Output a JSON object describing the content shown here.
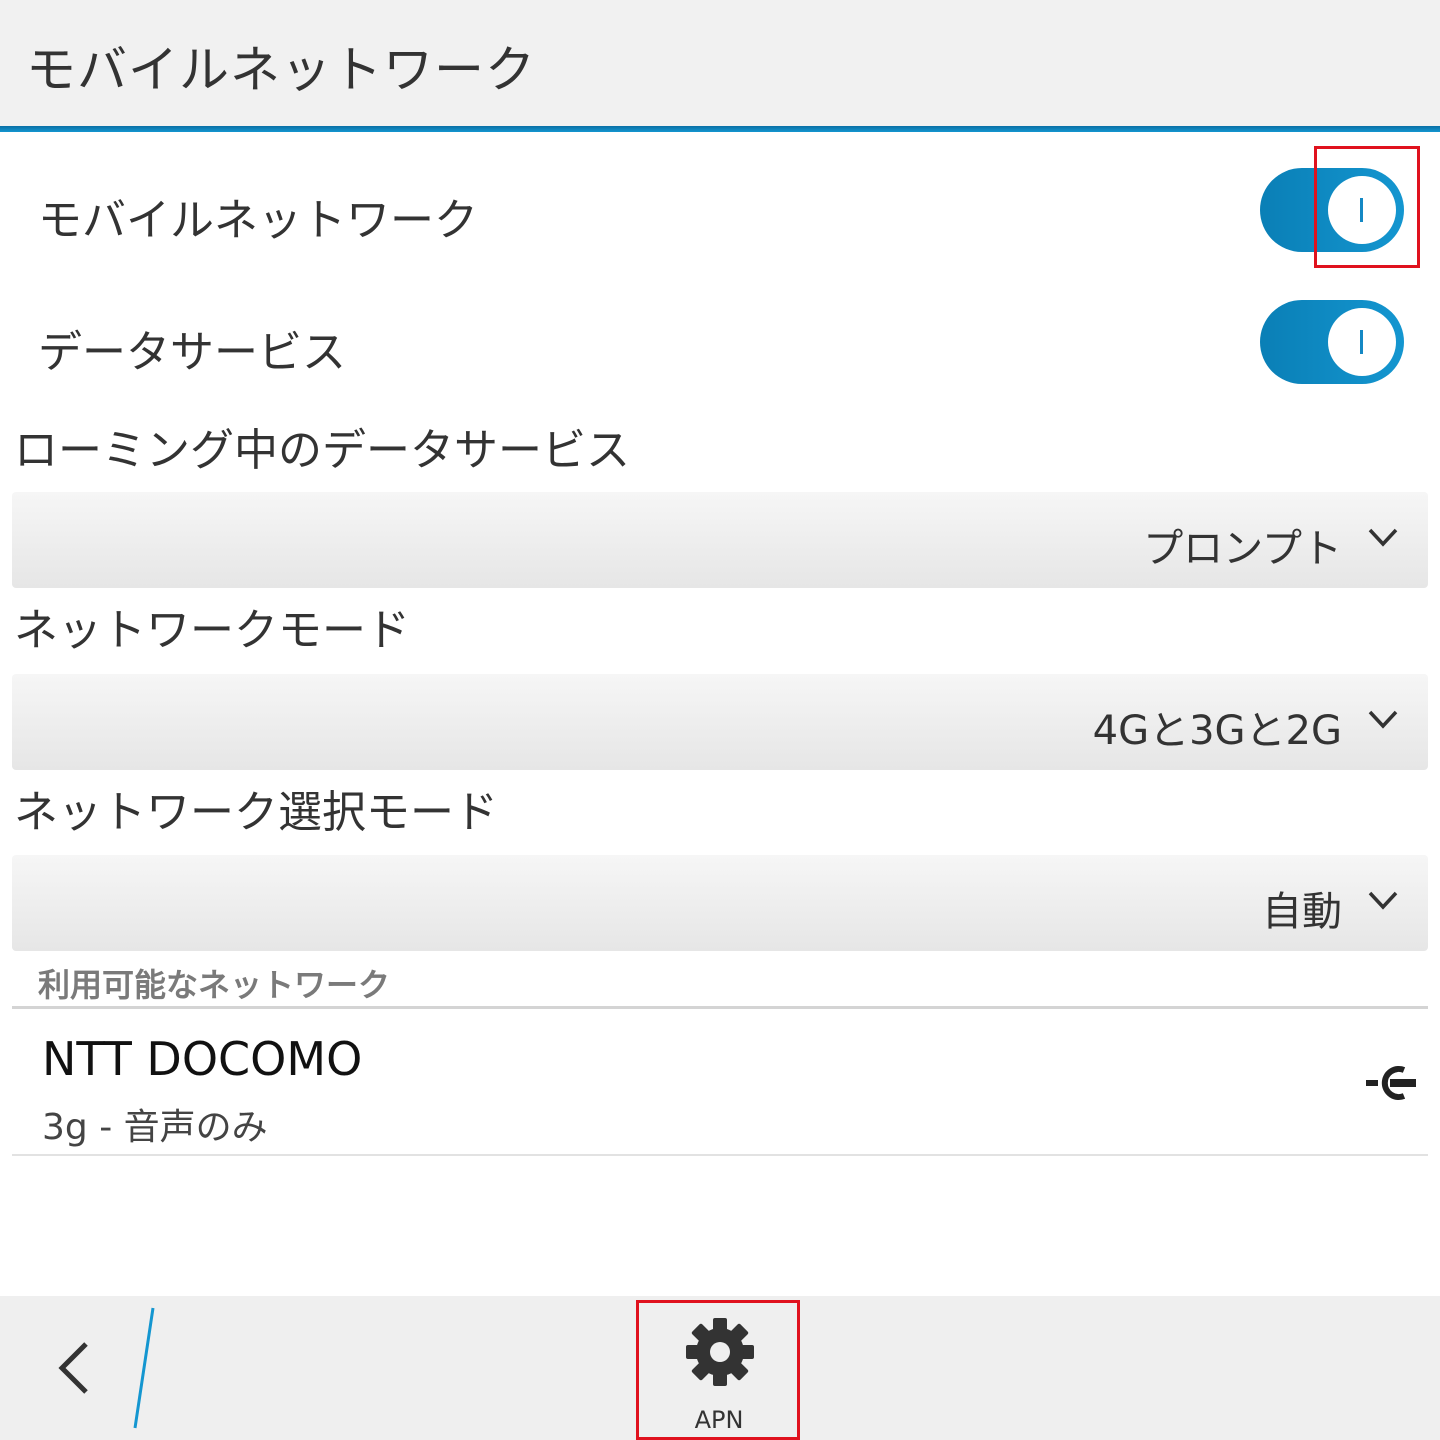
{
  "header": {
    "title": "モバイルネットワーク"
  },
  "mobile_network": {
    "label": "モバイルネットワーク",
    "state": "on"
  },
  "data_service": {
    "label": "データサービス",
    "state": "on"
  },
  "roaming": {
    "label": "ローミング中のデータサービス",
    "value": "プロンプト"
  },
  "network_mode": {
    "label": "ネットワークモード",
    "value": "4Gと3Gと2G"
  },
  "network_selection_mode": {
    "label": "ネットワーク選択モード",
    "value": "自動"
  },
  "available_networks": {
    "header": "利用可能なネットワーク",
    "items": [
      {
        "name": "NTT DOCOMO",
        "detail": "3g - 音声のみ",
        "icon": "connect-icon"
      }
    ]
  },
  "bottom_bar": {
    "back_icon": "chevron-left-icon",
    "apn": {
      "label": "APN",
      "icon": "gear-icon"
    }
  },
  "colors": {
    "accent": "#1496d0",
    "highlight": "#e0121e",
    "titlebar_bg": "#f1f1f1"
  }
}
